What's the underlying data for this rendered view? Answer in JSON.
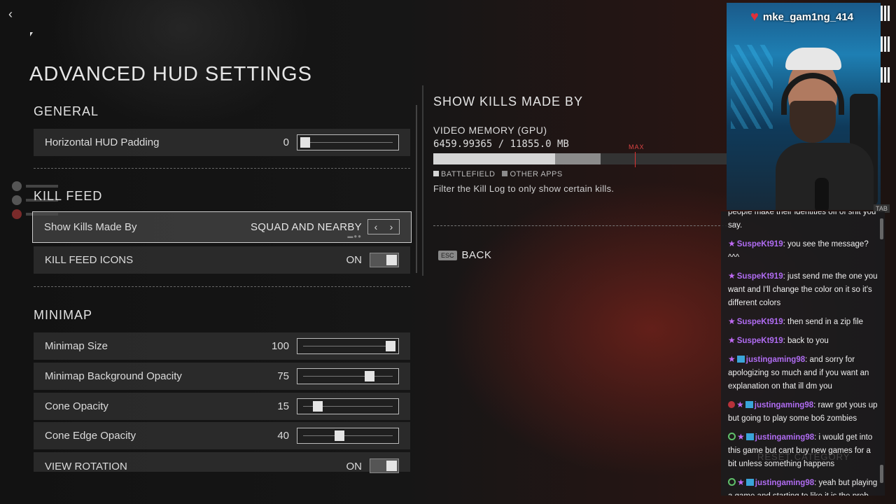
{
  "page": {
    "title": "ADVANCED HUD SETTINGS"
  },
  "sections": {
    "general": "GENERAL",
    "kill_feed": "KILL FEED",
    "minimap": "MINIMAP"
  },
  "settings": {
    "horizontal_hud_padding": {
      "label": "Horizontal HUD Padding",
      "value": "0",
      "level": 0.0
    },
    "show_kills_made_by": {
      "label": "Show Kills Made By",
      "value": "SQUAD AND NEARBY"
    },
    "kill_feed_icons": {
      "label": "KILL FEED ICONS",
      "value": "ON"
    },
    "minimap_size": {
      "label": "Minimap Size",
      "value": "100",
      "level": 1.0
    },
    "minimap_bg_opacity": {
      "label": "Minimap Background Opacity",
      "value": "75",
      "level": 0.75
    },
    "cone_opacity": {
      "label": "Cone Opacity",
      "value": "15",
      "level": 0.15
    },
    "cone_edge_opacity": {
      "label": "Cone Edge Opacity",
      "value": "40",
      "level": 0.4
    },
    "view_rotation": {
      "label": "VIEW ROTATION",
      "value": "ON"
    }
  },
  "detail": {
    "title": "SHOW KILLS MADE BY",
    "vmem_label": "VIDEO MEMORY (GPU)",
    "vmem_value": "6459.99365 / 11855.0 MB",
    "vmem_battlefield_fraction": 0.415,
    "vmem_other_apps_fraction": 0.155,
    "max_label": "MAX",
    "legend_battlefield": "BATTLEFIELD",
    "legend_other": "OTHER APPS",
    "description": "Filter the Kill Log to only show certain kills.",
    "back_key": "ESC",
    "back_label": "BACK",
    "colors": {
      "battlefield": "#d5d5d5",
      "other_apps": "#8b8b8b",
      "max": "#d33333"
    }
  },
  "stream": {
    "name": "mke_gam1ng_414",
    "tab_chip": "TAB",
    "ghost_text": "RESET CATEGORY"
  },
  "chat": [
    {
      "user": "",
      "text": "people make their identities off of shit you say."
    },
    {
      "user": "SuspeKt919",
      "text": ": you see the message? ^^^",
      "badges": [
        "star"
      ]
    },
    {
      "user": "SuspeKt919",
      "text": ": just send me the one you want and I'll change the color on it so it's different colors",
      "badges": [
        "star"
      ]
    },
    {
      "user": "SuspeKt919",
      "text": ": then send in a zip file",
      "badges": [
        "star"
      ]
    },
    {
      "user": "SuspeKt919",
      "text": ": back to you",
      "badges": [
        "star"
      ]
    },
    {
      "user": "justingaming98",
      "text": ": and sorry for apologizing so much and if you want an explanation on that ill dm you",
      "badges": [
        "star",
        "tv"
      ]
    },
    {
      "user": "justingaming98",
      "text": ": rawr got yous up but going to play some bo6 zombies",
      "badges": [
        "dot",
        "star",
        "tv"
      ]
    },
    {
      "user": "justingaming98",
      "text": ": i would get into this game but cant buy new games for a bit unless something happens",
      "badges": [
        "ring",
        "star",
        "tv"
      ]
    },
    {
      "user": "justingaming98",
      "text": ": yeah but playing a game and starting to like it is the prob",
      "badges": [
        "ring",
        "star",
        "tv"
      ]
    }
  ]
}
